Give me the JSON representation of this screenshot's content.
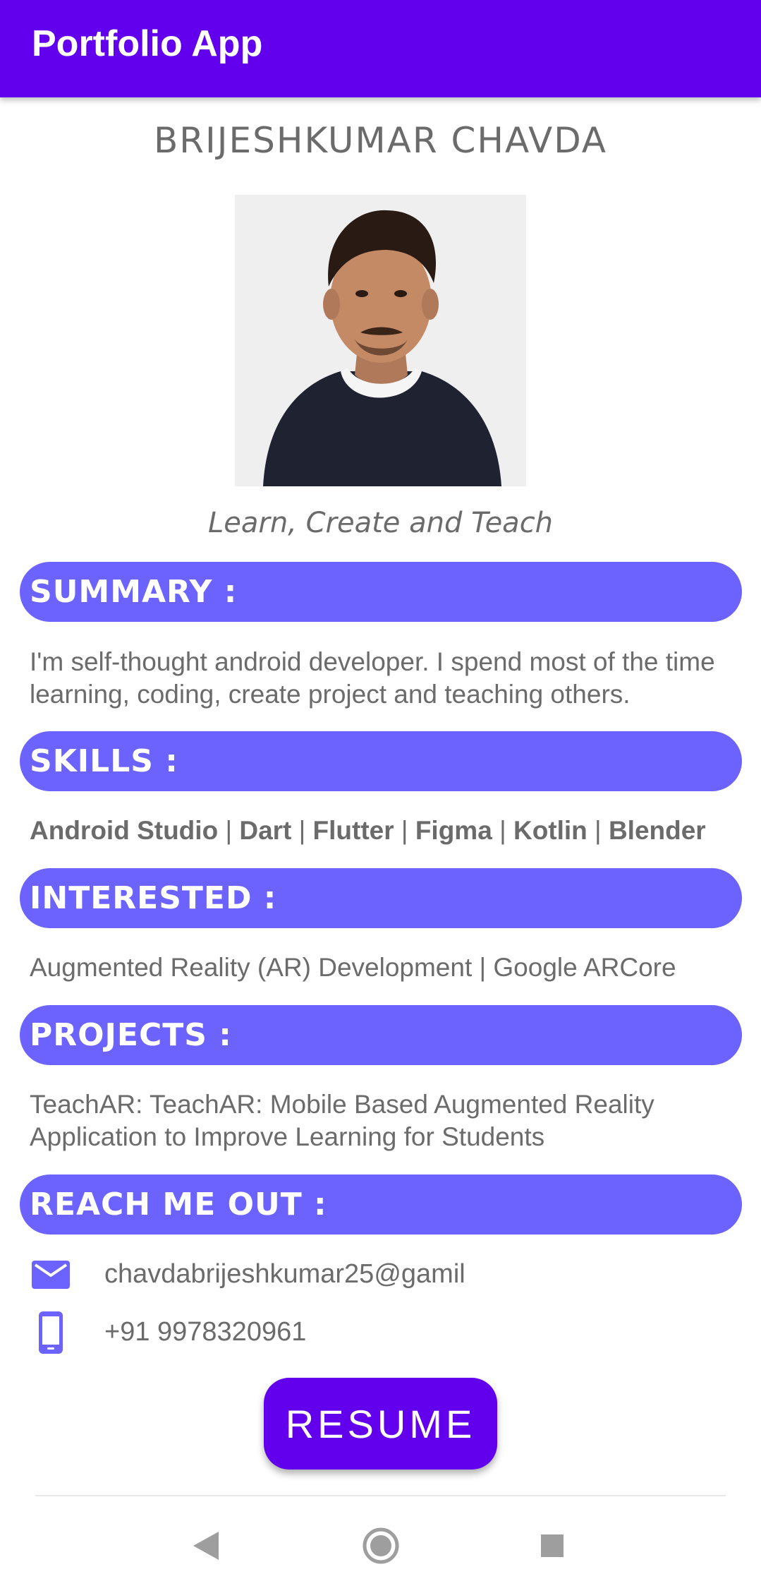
{
  "appbar": {
    "title": "Portfolio App"
  },
  "profile": {
    "name": "BRIJESHKUMAR CHAVDA",
    "tagline": "Learn, Create and Teach"
  },
  "summary": {
    "header": "SUMMARY :",
    "text": "I'm self-thought android developer. I spend most of the time learning, coding, create project and teaching others."
  },
  "skills": {
    "header": "SKILLS :",
    "items": [
      "Android Studio",
      "Dart",
      "Flutter",
      "Figma",
      "Kotlin",
      "Blender"
    ],
    "separator": " | "
  },
  "interested": {
    "header": "INTERESTED :",
    "text": "Augmented Reality (AR) Development | Google ARCore"
  },
  "projects": {
    "header": "PROJECTS :",
    "text": "TeachAR: TeachAR: Mobile Based Augmented Reality Application to Improve Learning for Students"
  },
  "reach": {
    "header": "REACH ME OUT :",
    "email": "chavdabrijeshkumar25@gamil",
    "phone": "+91 9978320961"
  },
  "resume_button": {
    "label": "RESUME"
  },
  "colors": {
    "appbar": "#6200ee",
    "section_header": "#6c63ff",
    "button": "#6200ee",
    "text": "#6b6b6b"
  },
  "icons": {
    "email": "mail-icon",
    "phone": "phone-icon",
    "nav_back": "back-triangle-icon",
    "nav_home": "home-circle-icon",
    "nav_recents": "recents-square-icon"
  }
}
